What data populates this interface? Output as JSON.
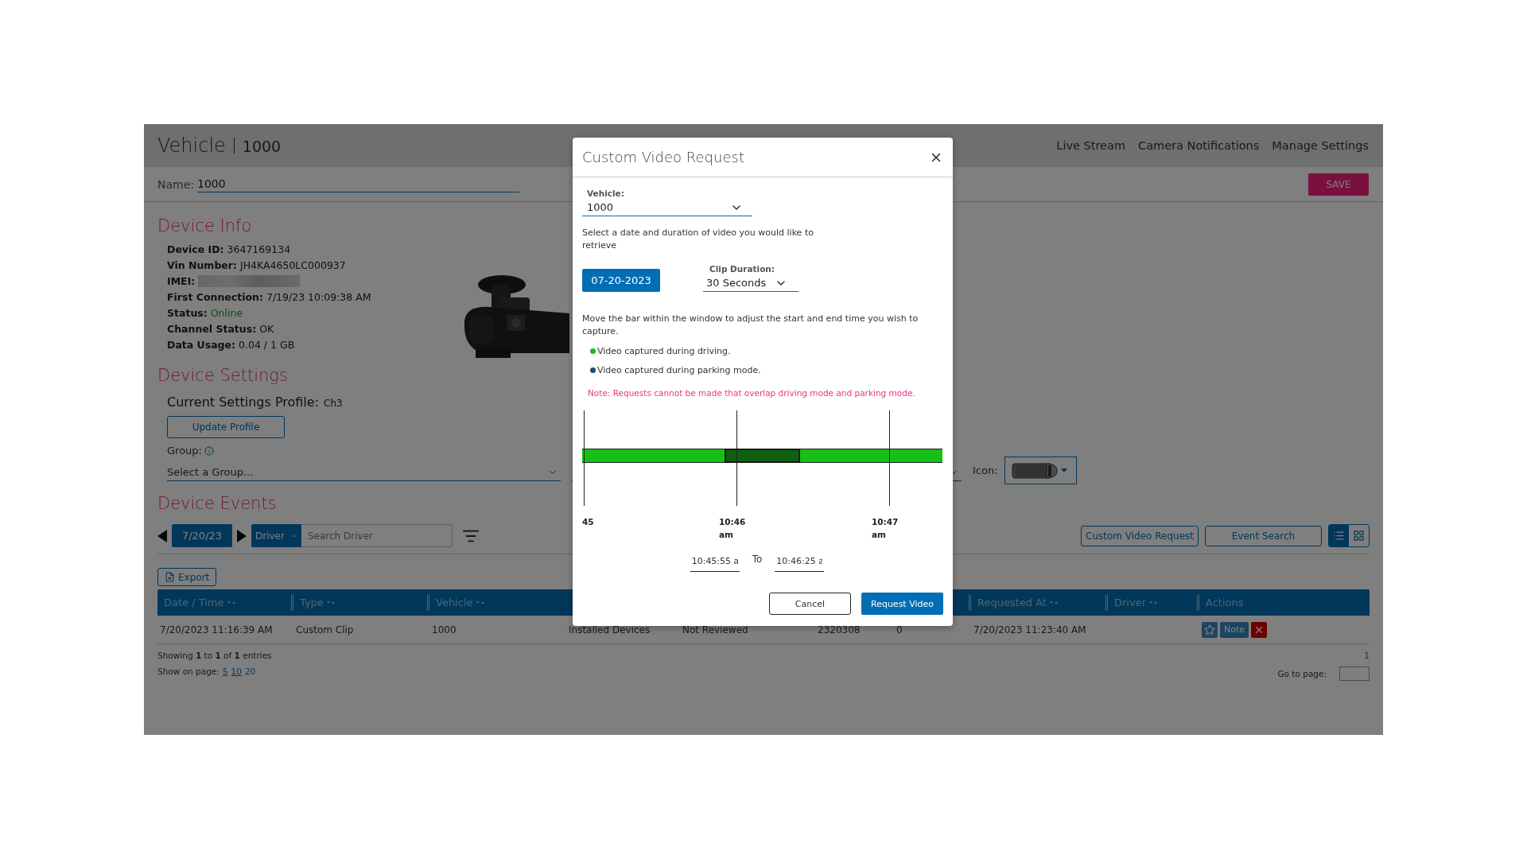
{
  "header": {
    "title": "Vehicle",
    "vehicle": "1000",
    "nav": [
      "Live Stream",
      "Camera Notifications",
      "Manage Settings"
    ]
  },
  "name_field": {
    "label": "Name:",
    "value": "1000"
  },
  "save_button": "SAVE",
  "device_info": {
    "heading": "Device Info",
    "fields": [
      {
        "label": "Device ID:",
        "value": "3647169134",
        "kind": "text"
      },
      {
        "label": "Vin Number:",
        "value": "JH4KA4650LC000937",
        "kind": "text"
      },
      {
        "label": "IMEI:",
        "kind": "redacted"
      },
      {
        "label": "First Connection:",
        "value": "7/19/23 10:09:38 AM",
        "kind": "text"
      },
      {
        "label": "Status:",
        "value": "Online",
        "kind": "status"
      },
      {
        "label": "Channel Status:",
        "value": "OK",
        "kind": "text"
      },
      {
        "label": "Data Usage:",
        "value": "0.04 / 1 GB",
        "kind": "text"
      }
    ]
  },
  "device_settings": {
    "heading": "Device Settings",
    "profile_label": "Current Settings Profile:",
    "profile": "Ch3",
    "update_button": "Update Profile",
    "group_label": "Group:",
    "group_placeholder": "Select a Group...",
    "icon_label": "Icon:"
  },
  "device_events": {
    "heading": "Device Events",
    "date": "7/20/23",
    "filter": "Driver",
    "search_placeholder": "Search Driver",
    "buttons": [
      "Custom Video Request",
      "Event Search"
    ],
    "views": [
      {
        "kind": "list",
        "selected": true
      },
      {
        "kind": "grid",
        "selected": false
      }
    ],
    "export": "Export",
    "table": {
      "columns_left": [
        "Date / Time",
        "Type",
        "Vehicle"
      ],
      "columns_right": [
        "Requested At",
        "Driver",
        "Actions"
      ],
      "rows": [
        {
          "cells": [
            "7/20/2023 11:16:39 AM",
            "Custom Clip",
            "1000",
            "Installed Devices",
            "Not Reviewed",
            "2320308",
            "0",
            "7/20/2023 11:23:40 AM"
          ],
          "note": "Note",
          "starred": false
        }
      ]
    },
    "summary": "Showing **1** to **1** of **1** entries",
    "page_size_label": "Show on page:",
    "page_sizes": [
      {
        "label": "5",
        "selected": false
      },
      {
        "label": "10",
        "selected": false
      },
      {
        "label": "20",
        "selected": true
      }
    ],
    "pages": [
      "1"
    ],
    "go_to_label": "Go to page:"
  },
  "modal": {
    "title": "Custom Video Request",
    "vehicle_label": "Vehicle:",
    "vehicle": "1000",
    "intro": "Select a date and duration of video you would like to retrieve",
    "date": "07-20-2023",
    "duration_label": "Clip Duration:",
    "duration": "30 Seconds",
    "instructions": "Move the bar within the window to adjust the start and end time you wish to capture.",
    "legend": [
      {
        "label": "Video captured during driving.",
        "color": "#16c016"
      },
      {
        "label": "Video captured during parking mode.",
        "color": "#1d4e75"
      }
    ],
    "note": "Note: Requests cannot be made that overlap driving mode and parking mode.",
    "timeline": {
      "ticks": [
        "45",
        "10:46 am",
        "10:47 am"
      ],
      "kind": "driving",
      "level": 0.5
    },
    "start_time": "10:45:55 a",
    "to": "To",
    "end_time": "10:46:25 a",
    "cancel": "Cancel",
    "submit": "Request Video"
  }
}
